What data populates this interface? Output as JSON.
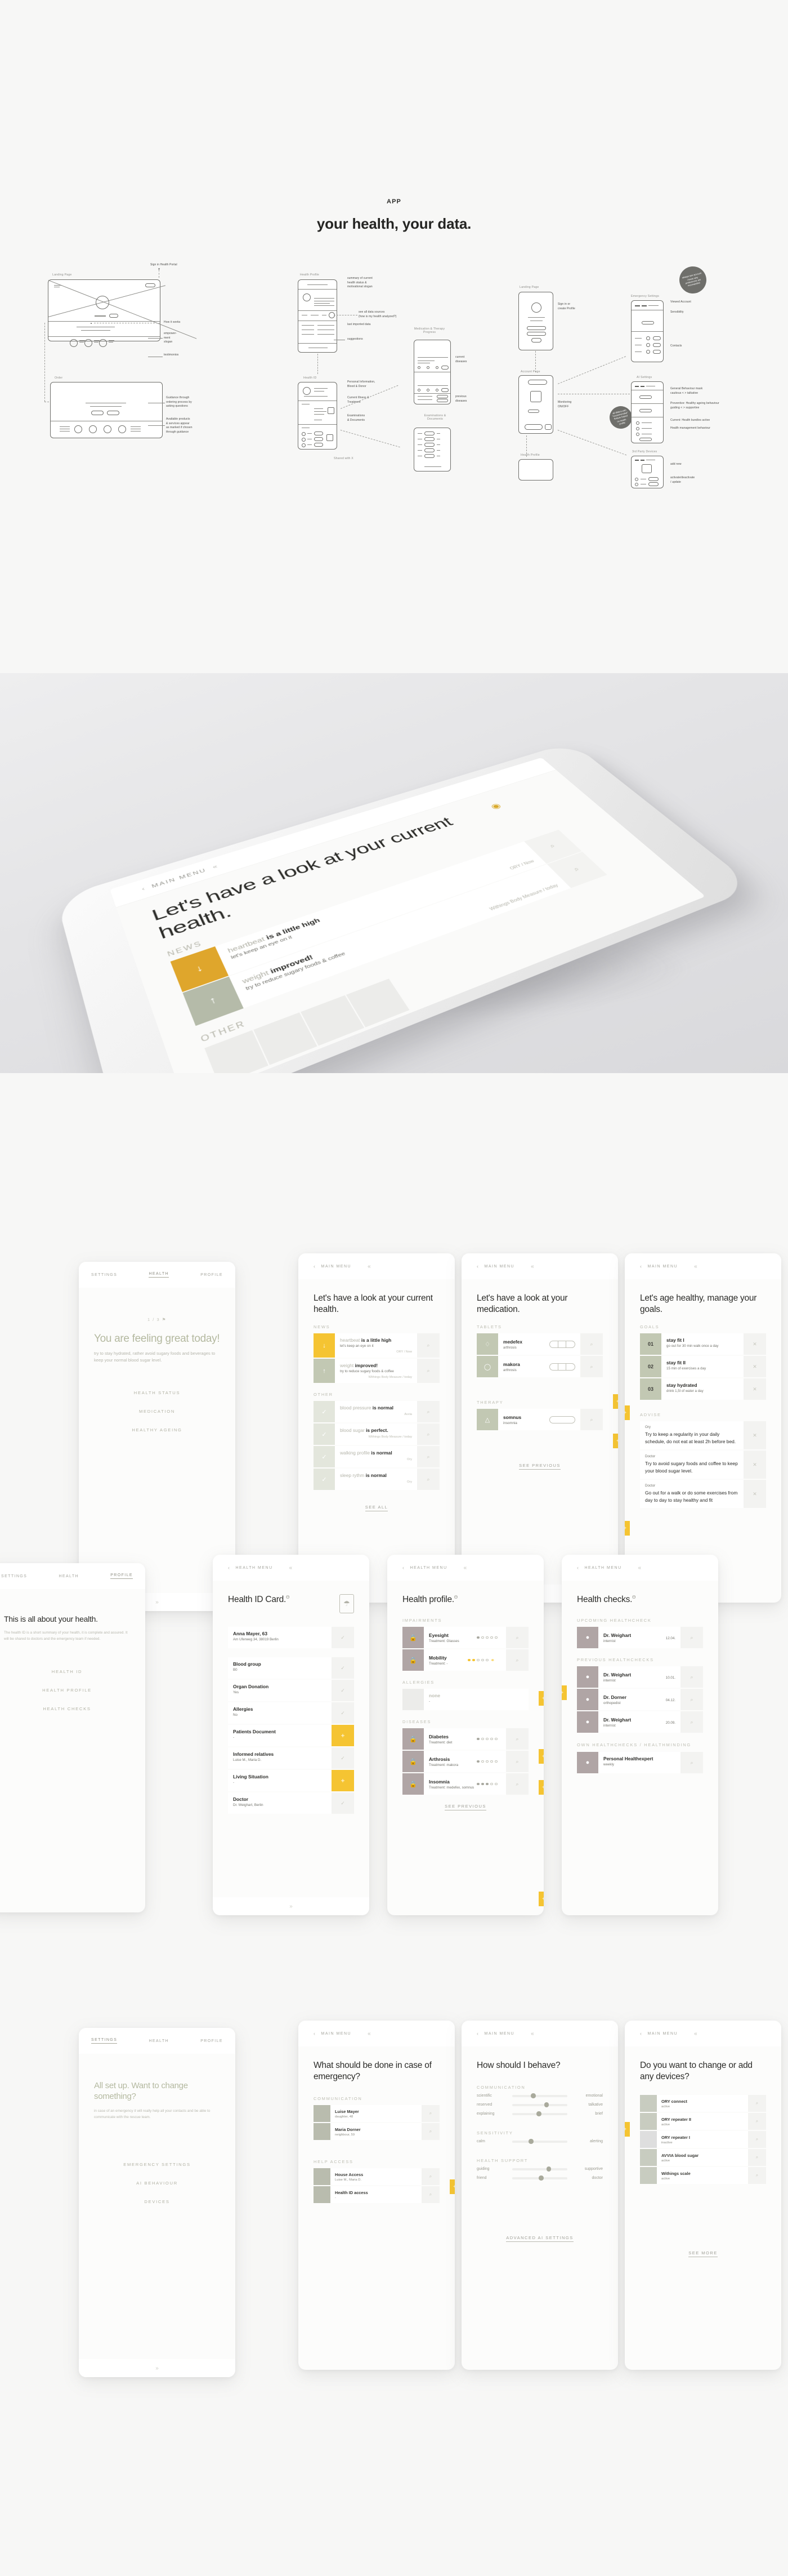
{
  "header": {
    "eyebrow": "APP",
    "title": "your health, your data."
  },
  "wireframes": {
    "group1": {
      "labels": [
        "Landing Page",
        "Order"
      ],
      "annotations": [
        "Sign in Health Portal",
        "How it works",
        "empower-\nment\nslogan",
        "testimonios",
        "Guidance through\nordering process by\nasking questions",
        "Available products\n& services appear\nas marked if chosen\nthrough guidance"
      ]
    },
    "group2": {
      "labels": [
        "Health Profile",
        "Health ID",
        "Medication & Therapy\nProgress",
        "Examinations &\nDocuments",
        "Shared with X"
      ],
      "annotations": [
        "summary of current\nhealth status &\nmotivational slogan",
        "see all data sources\n(how is my health analyzed?)",
        "last imported data",
        "suggestions",
        "Personal Information,\nBlood & Donor",
        "Current Illness &\nTreatment",
        "Examinations\n& Documents",
        "current diseases",
        "previous diseases"
      ]
    },
    "group3": {
      "labels": [
        "Landing Page",
        "Account Page",
        "Health Profile",
        "Emergency Settings",
        "AI Settings",
        "3rd Party Devices"
      ],
      "annotations": [
        "Sign in or\ncreate Profile",
        "Monitoring\nON/OFF",
        "Viewed Account",
        "Sensibility",
        "Contacts",
        "General Behaviour mask\ncautious < > talkative",
        "Preventive: Healthy ageing behaviour\nguiding < > supportive",
        "Current: Health bundles active",
        "Health management behaviour",
        "add new",
        "activate/deactivate\n/ update"
      ],
      "bubbles": [
        "always see account / know why preferences are recomanded",
        "all sliders with \"recommended\" feature based on health profile"
      ]
    }
  },
  "mockup": {
    "nav_label": "MAIN MENU",
    "heading": "Let's have a look at your current health.",
    "section_news": "NEWS",
    "section_other": "OTHER",
    "rows": [
      {
        "title_soft": "heartbeat",
        "title_bold": "is a little high",
        "sub": "let's keep an eye on it",
        "meta": "ORY / Now",
        "color": "#dfa62c",
        "arrow": "↓"
      },
      {
        "title_soft": "weight",
        "title_bold": "improved!",
        "sub": "try to reduce sugary foods & coffee",
        "meta": "Withings Body Measure / today",
        "color": "#b5bba9",
        "arrow": "↑"
      }
    ]
  },
  "screens": {
    "s1": {
      "tabs": [
        "SETTINGS",
        "HEALTH",
        "PROFILE"
      ],
      "active_tab": "HEALTH",
      "counter": "1 / 3",
      "headline": "You are feeling great today!",
      "sub": "try to stay hydrated, rather avoid sugary foods and beverages to keep your normal blood sugar level.",
      "links": [
        "HEALTH STATUS",
        "MEDICATION",
        "HEALTHY AGEING"
      ]
    },
    "s2": {
      "nav": "MAIN MENU",
      "headline": "Let's have a look at your current health.",
      "section_news": "NEWS",
      "section_other": "OTHER",
      "news": [
        {
          "soft": "heartbeat",
          "bold": "is a little high",
          "sub": "let's keep an eye on it",
          "meta": "ORY / Now",
          "color": "#f5c432",
          "arrow": "↓"
        },
        {
          "soft": "weight",
          "bold": "improved!",
          "sub": "try to reduce sugary foods & coffee",
          "meta": "Withings Body Measure / today",
          "color": "#c2c8b3",
          "arrow": "↑"
        }
      ],
      "other": [
        {
          "soft": "blood pressure",
          "bold": "is normal",
          "meta": "Avvia"
        },
        {
          "soft": "blood sugar",
          "bold": "is perfect.",
          "meta": "Withings Body Measure / today"
        },
        {
          "soft": "walking profile",
          "bold": "is normal",
          "meta": "Ory"
        },
        {
          "soft": "sleep rythm",
          "bold": "is normal",
          "meta": "Ory"
        }
      ],
      "see_all": "SEE ALL"
    },
    "s3": {
      "nav": "MAIN MENU",
      "headline": "Let's have a look at your medication.",
      "section_tablets": "TABLETS",
      "section_therapy": "THERAPY",
      "tablets": [
        {
          "name": "medefex",
          "sub": "arthrosis",
          "icon": "○"
        },
        {
          "name": "makora",
          "sub": "arthrosis",
          "icon": "○"
        }
      ],
      "therapy": [
        {
          "name": "somnus",
          "sub": "insomnia",
          "icon": "△"
        }
      ],
      "see_previous": "SEE PREVIOUS"
    },
    "s4": {
      "nav": "MAIN MENU",
      "headline": "Let's age healthy, manage your goals.",
      "section_goals": "GOALS",
      "section_advise": "ADVISE",
      "goals": [
        {
          "num": "01",
          "title": "stay fit I",
          "sub": "go out for 30 min walk once a day"
        },
        {
          "num": "02",
          "title": "stay fit II",
          "sub": "15 min of exercises a day"
        },
        {
          "num": "03",
          "title": "stay hydrated",
          "sub": "drink 1,5l of water a day"
        }
      ],
      "advise": [
        {
          "source": "Ory",
          "text": "Try to keep a regularity in your daily schedule, do not eat at least 2h before bed."
        },
        {
          "source": "Doctor",
          "text": "Try to avoid sugary foods and coffee to keep your blood sugar level."
        },
        {
          "source": "Doctor",
          "text": "Go out for a walk or do some exercises from day to day to stay healthy and fit"
        }
      ]
    },
    "s5": {
      "tabs": [
        "SETTINGS",
        "HEALTH",
        "PROFILE"
      ],
      "active_tab": "PROFILE",
      "headline": "This is all about your health.",
      "paragraph": "The health ID is a short summary of your health, it is complete and assured. It will be shared to doctors and the emergency team if needed.",
      "links": [
        "HEALTH ID",
        "HEALTH PROFILE",
        "HEALTH CHECKS"
      ]
    },
    "s6": {
      "nav": "HEALTH MENU",
      "headline": "Health ID Card.",
      "items": [
        {
          "label": "Anna Mayer, 63",
          "value": "Am Uferweg 34, 38019 Berlin",
          "action": "check"
        },
        {
          "label": "Blood group",
          "value": "B0",
          "action": "check"
        },
        {
          "label": "Organ Donation",
          "value": "Yes",
          "action": "check"
        },
        {
          "label": "Allergies",
          "value": "No",
          "action": "check"
        },
        {
          "label": "Patients Document",
          "value": "-",
          "action": "plus"
        },
        {
          "label": "Informed relatives",
          "value": "Luise M., Maria D.",
          "action": "check"
        },
        {
          "label": "Living Situation",
          "value": "-",
          "action": "plus"
        },
        {
          "label": "Doctor",
          "value": "Dr. Weighart, Berlin",
          "action": "check"
        }
      ]
    },
    "s7": {
      "nav": "HEALTH MENU",
      "headline": "Health profile.",
      "section_impairments": "IMPAIRMENTS",
      "section_allergies": "ALLERGIES",
      "section_diseases": "DISEASES",
      "impairments": [
        {
          "name": "Eyesight",
          "sub": "Treatment: Glasses",
          "level": 1,
          "shared": false
        },
        {
          "name": "Mobility",
          "sub": "Treatment: -",
          "level": 2,
          "shared": true
        }
      ],
      "allergies": [
        {
          "name": "none",
          "sub": "-"
        }
      ],
      "diseases": [
        {
          "name": "Diabetes",
          "sub": "Treatment: diet",
          "level": 1
        },
        {
          "name": "Arthrosis",
          "sub": "Treatment: makora",
          "level": 1
        },
        {
          "name": "Insomnia",
          "sub": "Treatment: medefex, somnus",
          "level": 3
        }
      ],
      "see_previous": "SEE PREVIOUS"
    },
    "s8": {
      "nav": "HEALTH MENU",
      "headline": "Health checks.",
      "section_upcoming": "UPCOMING HEALTHCHECK",
      "section_previous": "PREVIOUS HEALTHCHECKS",
      "section_own": "OWN HEALTHCHECKS / HEALTHMINDING",
      "upcoming": [
        {
          "name": "Dr. Weighart",
          "sub": "internist",
          "meta": "12.04."
        }
      ],
      "previous": [
        {
          "name": "Dr. Weighart",
          "sub": "internist",
          "meta": "10.01."
        },
        {
          "name": "Dr. Dorner",
          "sub": "orthopedist",
          "meta": "04.12."
        },
        {
          "name": "Dr. Weighart",
          "sub": "internist",
          "meta": "20.09."
        }
      ],
      "own": [
        {
          "name": "Personal Healthexpert",
          "sub": "weekly",
          "meta": ""
        }
      ]
    },
    "s9": {
      "tabs": [
        "SETTINGS",
        "HEALTH",
        "PROFILE"
      ],
      "active_tab": "SETTINGS",
      "headline": "All set up. Want to change something?",
      "paragraph": "in case of an emergency it will really help all your contacts and be able to communicate with the rescue team.",
      "links": [
        "EMERGENCY SETTINGS",
        "AI BEHAVIOUR",
        "DEVICES"
      ]
    },
    "s10": {
      "nav": "MAIN MENU",
      "headline": "What should be done in case of emergency?",
      "section_communication": "COMMUNICATION",
      "section_help": "HELP ACCESS",
      "contacts": [
        {
          "name": "Luise Mayer",
          "sub": "daughter, 48"
        },
        {
          "name": "Maria Dorner",
          "sub": "neighbour, 59"
        }
      ],
      "help": [
        {
          "name": "House Access",
          "sub": "Luise M., Maria D."
        },
        {
          "name": "Health ID access",
          "sub": "-"
        }
      ]
    },
    "s11": {
      "nav": "MAIN MENU",
      "headline": "How should I behave?",
      "section_communication": "COMMUNICATION",
      "section_sensitivity": "SENSITIVITY",
      "section_support": "HEALTH SUPPORT",
      "sliders": [
        {
          "left": "scientific",
          "right": "emotional",
          "pos": 34
        },
        {
          "left": "reserved",
          "right": "talkative",
          "pos": 58
        },
        {
          "left": "explaining",
          "right": "brief",
          "pos": 44
        },
        {
          "left": "calm",
          "right": "alerting",
          "pos": 30
        },
        {
          "left": "guiding",
          "right": "supportive",
          "pos": 62
        },
        {
          "left": "friend",
          "right": "doctor",
          "pos": 48
        }
      ],
      "link": "ADVANCED AI SETTINGS"
    },
    "s12": {
      "nav": "MAIN MENU",
      "headline": "Do you want to change or add any devices?",
      "devices": [
        {
          "name": "ORY connect",
          "sub": "active"
        },
        {
          "name": "ORY repeater II",
          "sub": "active"
        },
        {
          "name": "ORY repeater I",
          "sub": "inactive"
        },
        {
          "name": "AVVIA blood sugar",
          "sub": "active"
        },
        {
          "name": "Withings scale",
          "sub": "active"
        }
      ],
      "link": "SEE MORE"
    }
  },
  "icons": {
    "search": "⌕",
    "check": "✓",
    "plus": "+",
    "close": "✕",
    "chevron_left": "‹",
    "chevron_up": "«",
    "chevron_down": "»",
    "lock": "Θ",
    "flag": "⚑",
    "eye": "◉",
    "share": "⚭"
  },
  "colors": {
    "accent_yellow": "#f5c432",
    "accent_gold": "#d9a92a",
    "accent_olive": "#c2c8b3",
    "muted_mauve": "#b0a5a5",
    "bg": "#f7f7f6",
    "text": "#2b2b28"
  }
}
